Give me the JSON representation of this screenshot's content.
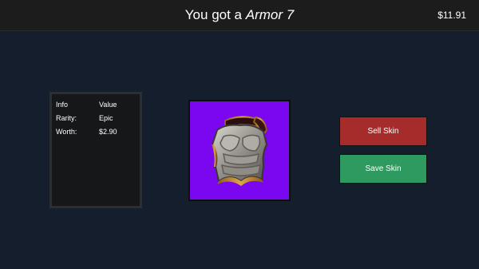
{
  "header": {
    "title_prefix": "You got a",
    "item_name": "Armor 7",
    "balance": "$11.91"
  },
  "info": {
    "header_key": "Info",
    "header_value": "Value",
    "rows": [
      {
        "key": "Rarity:",
        "value": "Epic"
      },
      {
        "key": "Worth:",
        "value": "$2.90"
      }
    ]
  },
  "skin": {
    "icon": "armor-chestplate-icon",
    "rarity_color": "#7b06f0"
  },
  "actions": {
    "sell_label": "Sell Skin",
    "save_label": "Save Skin"
  },
  "colors": {
    "background": "#141e2c",
    "sell": "#a62c2c",
    "save": "#2e9a60"
  }
}
